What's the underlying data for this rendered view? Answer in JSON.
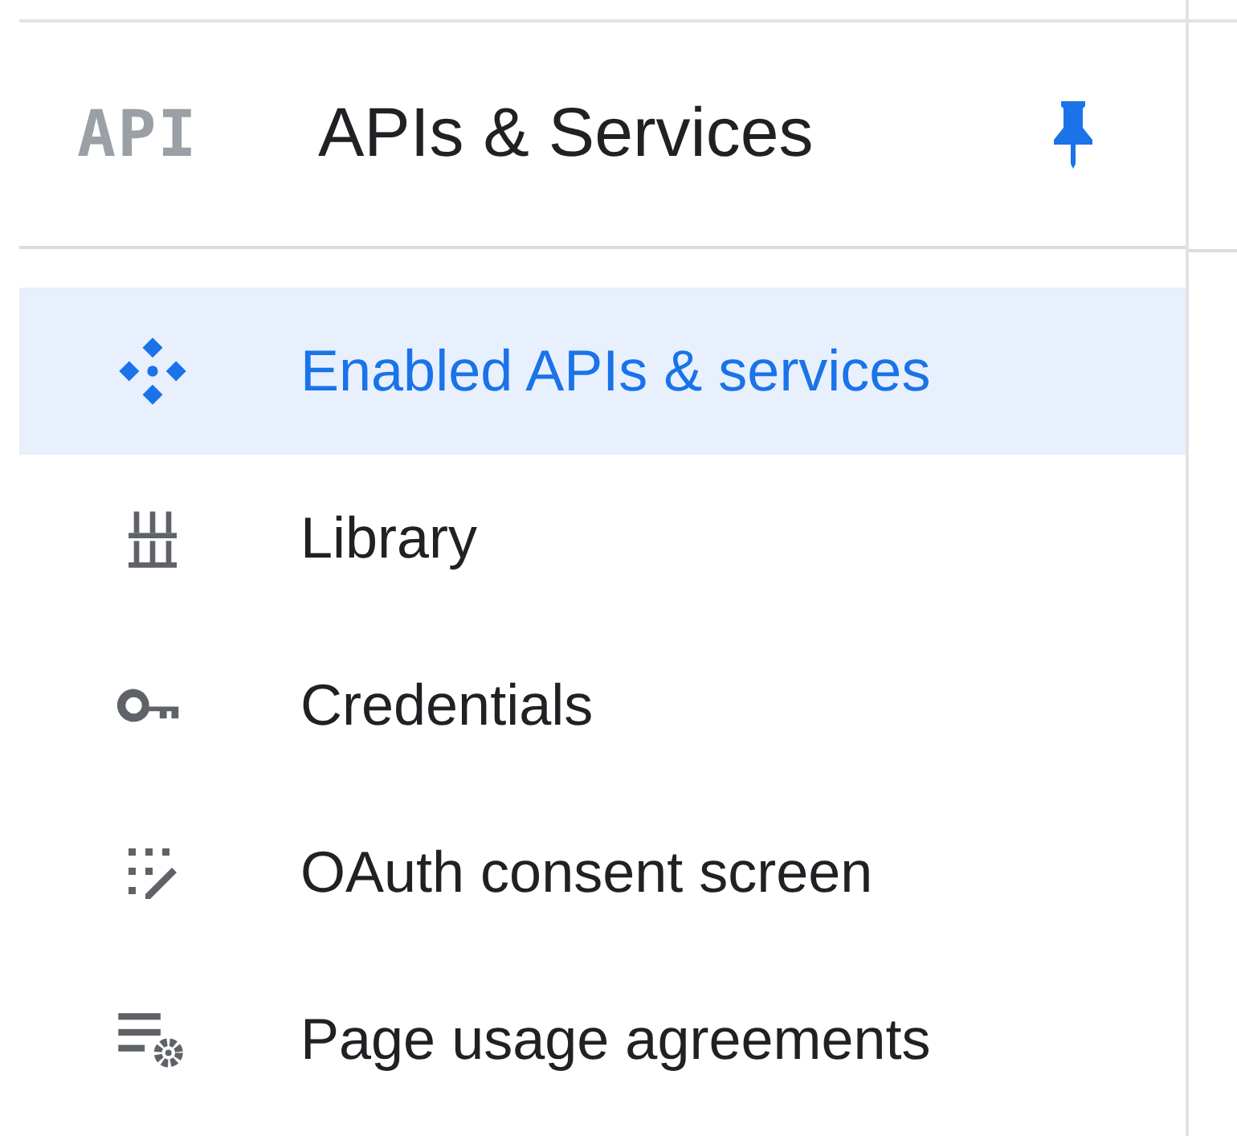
{
  "header": {
    "logo": "API",
    "title": "APIs & Services",
    "pinned": true
  },
  "nav": [
    {
      "label": "Enabled APIs & services",
      "kind": "apis",
      "selected": true
    },
    {
      "label": "Library",
      "kind": "library",
      "selected": false
    },
    {
      "label": "Credentials",
      "kind": "key",
      "selected": false
    },
    {
      "label": "OAuth consent screen",
      "kind": "consent",
      "selected": false
    },
    {
      "label": "Page usage agreements",
      "kind": "settings-list",
      "selected": false
    }
  ]
}
